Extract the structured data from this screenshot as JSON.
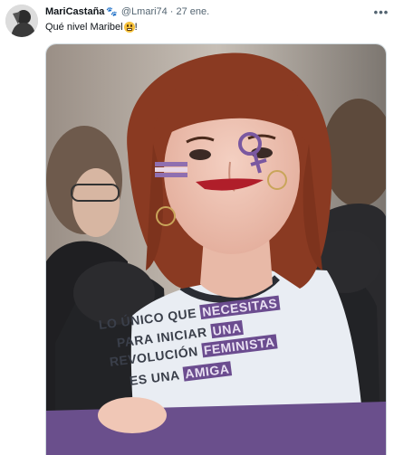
{
  "tweet": {
    "author": {
      "display_name": "MariCastaña",
      "name_emoji_icon": "paw-prints-icon",
      "handle": "@Lmari74"
    },
    "separator": "·",
    "date": "27 ene.",
    "more_label": "•••",
    "text": "Qué nivel Maribel",
    "text_emoji_icon": "grimacing-face-icon",
    "text_suffix": "!",
    "media": {
      "shirt_lines": [
        {
          "before": "LO ÚNICO QUE ",
          "highlight": "NECESITAS"
        },
        {
          "before": "PARA INICIAR ",
          "highlight": "UNA"
        },
        {
          "before": "REVOLUCIÓN ",
          "highlight": "FEMINISTA"
        },
        {
          "before": "ES UNA ",
          "highlight": "AMIGA"
        }
      ],
      "colors": {
        "hair": "#8a3a22",
        "skin": "#f1c7b8",
        "shirt": "#e9edf3",
        "banner": "#6a4f8c",
        "jacket": "#222326"
      }
    }
  }
}
